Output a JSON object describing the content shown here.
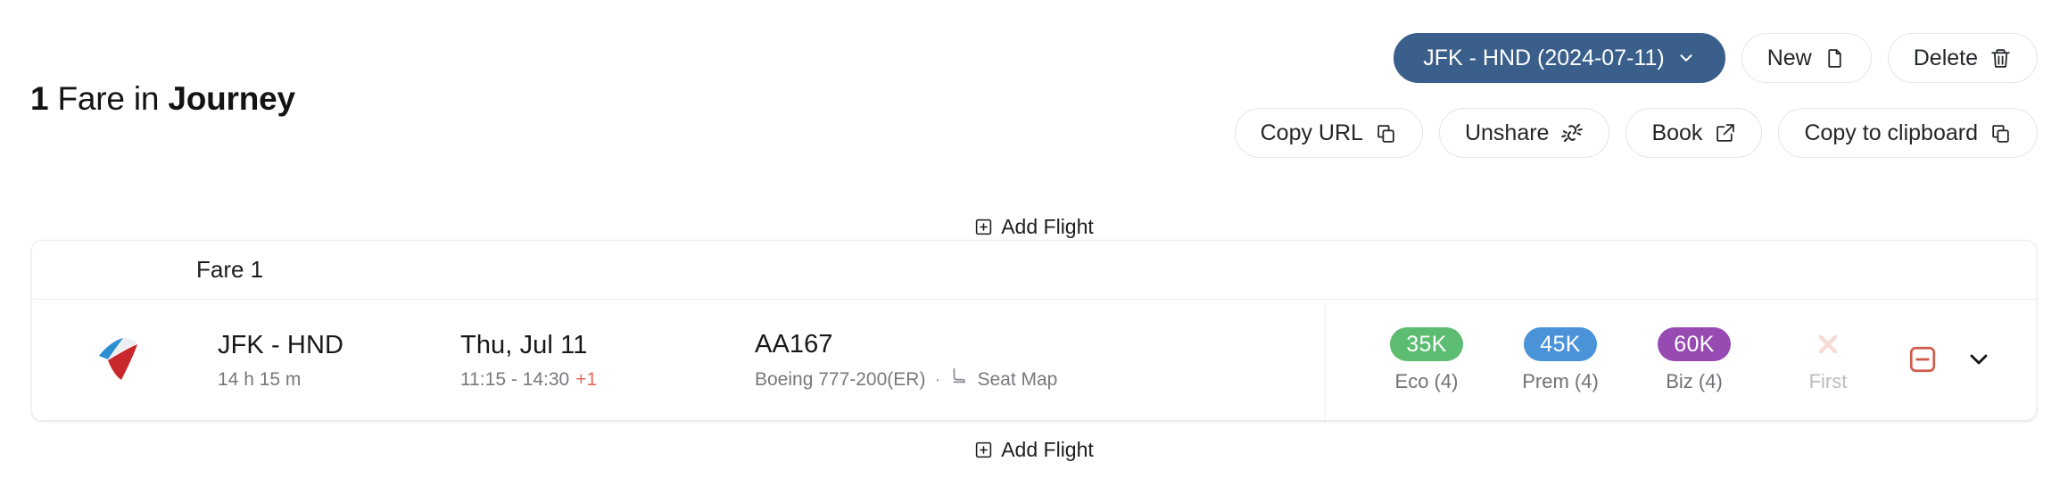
{
  "header": {
    "count": "1",
    "title_mid": "Fare in",
    "title_strong": "Journey"
  },
  "toolbar": {
    "row1": [
      {
        "label": "JFK - HND (2024-07-11)",
        "icon": "chevron-down-icon",
        "style": "primary",
        "name": "journey-selector-button"
      },
      {
        "label": "New",
        "icon": "new-document-icon",
        "style": "default",
        "name": "new-button"
      },
      {
        "label": "Delete",
        "icon": "trash-icon",
        "style": "default",
        "name": "delete-button"
      }
    ],
    "row2": [
      {
        "label": "Copy URL",
        "icon": "copy-icon",
        "style": "default",
        "name": "copy-url-button"
      },
      {
        "label": "Unshare",
        "icon": "unlink-icon",
        "style": "default",
        "name": "unshare-button"
      },
      {
        "label": "Book",
        "icon": "external-link-icon",
        "style": "default",
        "name": "book-button"
      },
      {
        "label": "Copy to clipboard",
        "icon": "copy-icon",
        "style": "default",
        "name": "copy-to-clipboard-button"
      }
    ]
  },
  "add_flight": {
    "top_label": "Add Flight",
    "bottom_label": "Add Flight"
  },
  "card": {
    "fare_header": "Fare 1",
    "flight": {
      "airline_logo": "american-airlines-logo",
      "route": "JFK - HND",
      "duration": "14 h 15 m",
      "date": "Thu, Jul 11",
      "times": "11:15 - 14:30",
      "day_offset": "+1",
      "flight_number": "AA167",
      "aircraft": "Boeing 777-200(ER)",
      "separator": "·",
      "seat_map_label": "Seat Map"
    },
    "fares": [
      {
        "price": "35K",
        "name": "Eco (4)",
        "color": "#5cbd72",
        "available": true
      },
      {
        "price": "45K",
        "name": "Prem (4)",
        "color": "#4a93d9",
        "available": true
      },
      {
        "price": "60K",
        "name": "Biz (4)",
        "color": "#974bb2",
        "available": true
      },
      {
        "price": "",
        "name": "First",
        "color": "#f7dcd9",
        "available": false
      }
    ],
    "actions": {
      "remove_label": "remove-flight-icon",
      "expand_label": "expand-row-icon",
      "remove_color": "#cf5b48"
    }
  }
}
